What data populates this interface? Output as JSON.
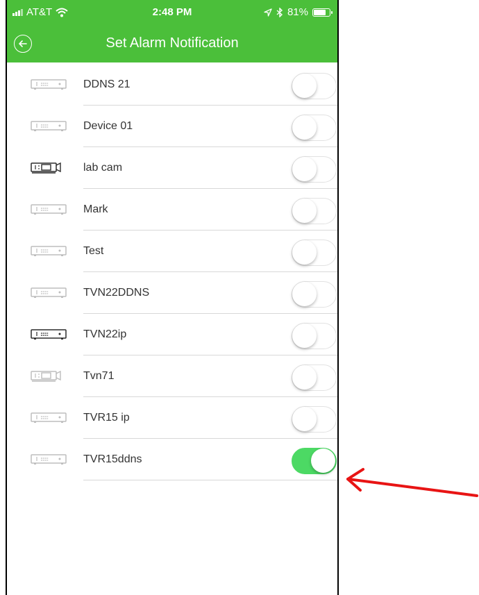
{
  "status_bar": {
    "carrier": "AT&T",
    "time": "2:48 PM",
    "battery": "81%",
    "battery_level": 0.81
  },
  "header": {
    "title": "Set Alarm Notification"
  },
  "devices": [
    {
      "name": "DDNS 21",
      "icon": "dvr-icon",
      "active": false,
      "enabled": false
    },
    {
      "name": "Device 01",
      "icon": "dvr-icon",
      "active": false,
      "enabled": false
    },
    {
      "name": "lab cam",
      "icon": "ipc-camera-icon",
      "active": true,
      "enabled": false
    },
    {
      "name": "Mark",
      "icon": "dvr-icon",
      "active": false,
      "enabled": false
    },
    {
      "name": "Test",
      "icon": "dvr-icon",
      "active": false,
      "enabled": false
    },
    {
      "name": "TVN22DDNS",
      "icon": "dvr-icon",
      "active": false,
      "enabled": false
    },
    {
      "name": "TVN22ip",
      "icon": "dvr-icon",
      "active": true,
      "enabled": false
    },
    {
      "name": "Tvn71",
      "icon": "ipc-camera-icon",
      "active": false,
      "enabled": false
    },
    {
      "name": "TVR15 ip",
      "icon": "dvr-icon",
      "active": false,
      "enabled": false
    },
    {
      "name": "TVR15ddns",
      "icon": "dvr-icon",
      "active": false,
      "enabled": true
    }
  ],
  "colors": {
    "header_green": "#4bbf3a",
    "toggle_on": "#4cd964",
    "annotation_arrow": "#e81414"
  }
}
